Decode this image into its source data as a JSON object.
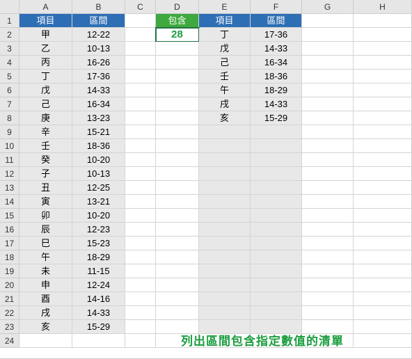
{
  "columns": [
    {
      "label": "A",
      "width": 76
    },
    {
      "label": "B",
      "width": 76
    },
    {
      "label": "C",
      "width": 44
    },
    {
      "label": "D",
      "width": 62
    },
    {
      "label": "E",
      "width": 74
    },
    {
      "label": "F",
      "width": 74
    },
    {
      "label": "G",
      "width": 74
    },
    {
      "label": "H",
      "width": 84
    }
  ],
  "row_count": 24,
  "headers": {
    "A1": "項目",
    "B1": "區間",
    "D1": "包含",
    "E1": "項目",
    "F1": "區間"
  },
  "table_left": [
    {
      "item": "甲",
      "range": "12-22"
    },
    {
      "item": "乙",
      "range": "10-13"
    },
    {
      "item": "丙",
      "range": "16-26"
    },
    {
      "item": "丁",
      "range": "17-36"
    },
    {
      "item": "戊",
      "range": "14-33"
    },
    {
      "item": "己",
      "range": "16-34"
    },
    {
      "item": "庚",
      "range": "13-23"
    },
    {
      "item": "辛",
      "range": "15-21"
    },
    {
      "item": "壬",
      "range": "18-36"
    },
    {
      "item": "癸",
      "range": "10-20"
    },
    {
      "item": "子",
      "range": "10-13"
    },
    {
      "item": "丑",
      "range": "12-25"
    },
    {
      "item": "寅",
      "range": "13-21"
    },
    {
      "item": "卯",
      "range": "10-20"
    },
    {
      "item": "辰",
      "range": "12-23"
    },
    {
      "item": "巳",
      "range": "15-23"
    },
    {
      "item": "午",
      "range": "18-29"
    },
    {
      "item": "未",
      "range": "11-15"
    },
    {
      "item": "申",
      "range": "12-24"
    },
    {
      "item": "酉",
      "range": "14-16"
    },
    {
      "item": "戌",
      "range": "14-33"
    },
    {
      "item": "亥",
      "range": "15-29"
    }
  ],
  "contain_value": "28",
  "table_right": [
    {
      "item": "丁",
      "range": "17-36"
    },
    {
      "item": "戊",
      "range": "14-33"
    },
    {
      "item": "己",
      "range": "16-34"
    },
    {
      "item": "壬",
      "range": "18-36"
    },
    {
      "item": "午",
      "range": "18-29"
    },
    {
      "item": "戌",
      "range": "14-33"
    },
    {
      "item": "亥",
      "range": "15-29"
    }
  ],
  "footer": "列出區間包含指定數值的清單"
}
